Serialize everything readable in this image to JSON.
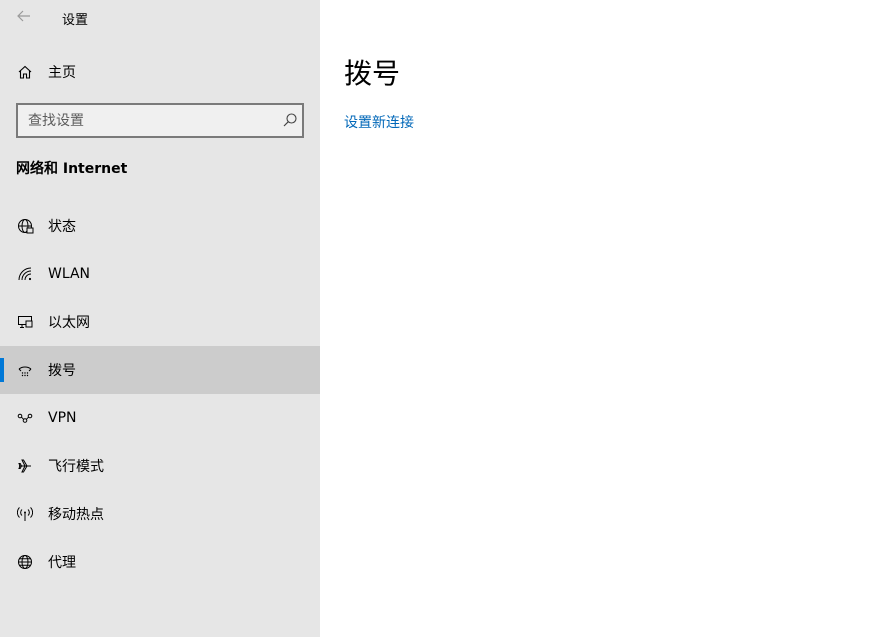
{
  "window": {
    "title": "设置"
  },
  "sidebar": {
    "home_label": "主页",
    "search": {
      "placeholder": "查找设置",
      "value": ""
    },
    "section_heading": "网络和 Internet",
    "items": [
      {
        "label": "状态",
        "icon": "globe-status-icon"
      },
      {
        "label": "WLAN",
        "icon": "wifi-icon"
      },
      {
        "label": "以太网",
        "icon": "ethernet-icon"
      },
      {
        "label": "拨号",
        "icon": "dialup-icon",
        "active": true
      },
      {
        "label": "VPN",
        "icon": "vpn-icon"
      },
      {
        "label": "飞行模式",
        "icon": "airplane-icon"
      },
      {
        "label": "移动热点",
        "icon": "hotspot-icon"
      },
      {
        "label": "代理",
        "icon": "globe-icon"
      }
    ]
  },
  "main": {
    "title": "拨号",
    "link": "设置新连接"
  },
  "colors": {
    "accent": "#0078d7",
    "link": "#0067b8",
    "sidebar_bg": "#e6e6e6",
    "active_bg": "#cccccc"
  }
}
